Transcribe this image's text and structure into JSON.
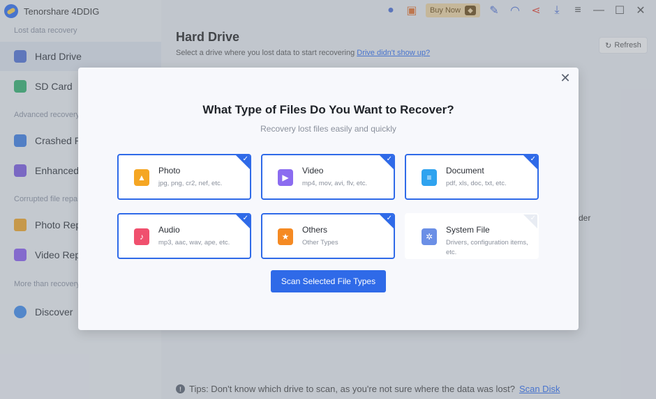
{
  "app": {
    "name": "Tenorshare 4DDIG"
  },
  "topbar": {
    "buy_now": "Buy Now"
  },
  "sidebar": {
    "sections": [
      {
        "label": "Lost data recovery"
      },
      {
        "label": "Advanced recovery"
      },
      {
        "label": "Corrupted file repa"
      },
      {
        "label": "More than recovery"
      }
    ],
    "items": [
      {
        "label": "Hard Drive"
      },
      {
        "label": "SD Card"
      },
      {
        "label": "Crashed PC"
      },
      {
        "label": "Enhanced V"
      },
      {
        "label": "Photo Repa"
      },
      {
        "label": "Video Repa"
      },
      {
        "label": "Discover"
      }
    ]
  },
  "main": {
    "title": "Hard Drive",
    "subtitle": "Select a drive where you lost data to start recovering",
    "subtitle_link": "Drive didn't show up?",
    "refresh": "Refresh",
    "bg_card_text": "der",
    "tips_text": "Tips: Don't know which drive to scan, as you're not sure where the data was lost?",
    "tips_link": "Scan Disk"
  },
  "modal": {
    "title": "What Type of Files Do You Want to Recover?",
    "subtitle": "Recovery lost files easily and quickly",
    "file_types": [
      {
        "name": "Photo",
        "desc": "jpg, png, cr2, nef, etc.",
        "selected": true,
        "icon": "photo-icon",
        "color": "#f5a623"
      },
      {
        "name": "Video",
        "desc": "mp4, mov, avi, flv, etc.",
        "selected": true,
        "icon": "video-icon",
        "color": "#8b6cf0"
      },
      {
        "name": "Document",
        "desc": "pdf, xls, doc, txt, etc.",
        "selected": true,
        "icon": "document-icon",
        "color": "#2fa3ef"
      },
      {
        "name": "Audio",
        "desc": "mp3, aac, wav, ape, etc.",
        "selected": true,
        "icon": "audio-icon",
        "color": "#f0506e"
      },
      {
        "name": "Others",
        "desc": "Other Types",
        "selected": true,
        "icon": "others-icon",
        "color": "#f58a23"
      },
      {
        "name": "System File",
        "desc": "Drivers, configuration items, etc.",
        "selected": false,
        "icon": "system-file-icon",
        "color": "#6b8fe6"
      }
    ],
    "scan_button": "Scan Selected File Types"
  }
}
